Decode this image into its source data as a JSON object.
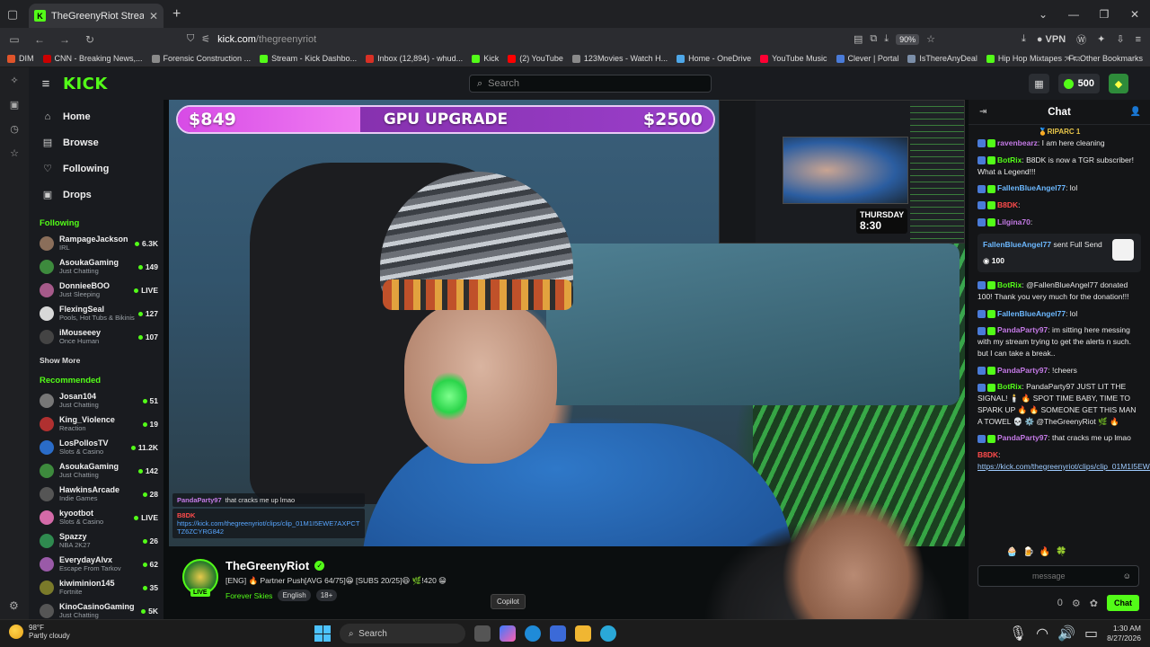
{
  "browser": {
    "tab_title": "TheGreenyRiot Stream - Watch",
    "url_host": "kick.com",
    "url_path": "/thegreenyriot",
    "zoom": "90%",
    "vpn_label": "VPN",
    "bookmarks": [
      {
        "label": "DIM",
        "color": "#e0542a"
      },
      {
        "label": "CNN - Breaking News,...",
        "color": "#cc0000"
      },
      {
        "label": "Forensic Construction ...",
        "color": "#8a8a8a"
      },
      {
        "label": "Stream - Kick Dashbo...",
        "color": "#53fc18"
      },
      {
        "label": "Inbox (12,894) - whud...",
        "color": "#d93025"
      },
      {
        "label": "Kick",
        "color": "#53fc18"
      },
      {
        "label": "(2) YouTube",
        "color": "#ff0000"
      },
      {
        "label": "123Movies - Watch H...",
        "color": "#8a8a8a"
      },
      {
        "label": "Home - OneDrive",
        "color": "#4ea7e8"
      },
      {
        "label": "YouTube Music",
        "color": "#ff0033"
      },
      {
        "label": "Clever | Portal",
        "color": "#4a7bd8"
      },
      {
        "label": "IsThereAnyDeal",
        "color": "#7b8ea8"
      },
      {
        "label": "Hip Hop Mixtapes : Fr...",
        "color": "#53fc18"
      }
    ],
    "other_bookmarks": "Other Bookmarks"
  },
  "kick": {
    "logo": "KICK",
    "search_placeholder": "Search",
    "kicks_balance": "500",
    "nav": [
      {
        "label": "Home",
        "icon": "home-icon",
        "glyph": "⌂"
      },
      {
        "label": "Browse",
        "icon": "browse-icon",
        "glyph": "▤"
      },
      {
        "label": "Following",
        "icon": "heart-icon",
        "glyph": "♡"
      },
      {
        "label": "Drops",
        "icon": "drops-icon",
        "glyph": "▣"
      }
    ],
    "following_title": "Following",
    "following": [
      {
        "name": "RampageJackson",
        "category": "IRL",
        "viewers": "6.3K",
        "color": "#8a6e5a"
      },
      {
        "name": "AsoukaGaming",
        "category": "Just Chatting",
        "viewers": "149",
        "color": "#3d8a3d"
      },
      {
        "name": "DonnieeBOO",
        "category": "Just Sleeping",
        "viewers": "LIVE",
        "color": "#a65a8a"
      },
      {
        "name": "FlexingSeal",
        "category": "Pools, Hot Tubs & Bikinis",
        "viewers": "127",
        "color": "#d8d8d8"
      },
      {
        "name": "iMouseeey",
        "category": "Once Human",
        "viewers": "107",
        "color": "#444"
      }
    ],
    "show_more": "Show More",
    "recommended_title": "Recommended",
    "recommended": [
      {
        "name": "Josan104",
        "category": "Just Chatting",
        "viewers": "51",
        "color": "#777"
      },
      {
        "name": "King_Violence",
        "category": "Reaction",
        "viewers": "19",
        "color": "#b03030"
      },
      {
        "name": "LosPollosTV",
        "category": "Slots & Casino",
        "viewers": "11.2K",
        "color": "#2a6cc8"
      },
      {
        "name": "AsoukaGaming",
        "category": "Just Chatting",
        "viewers": "142",
        "color": "#3d8a3d"
      },
      {
        "name": "HawkinsArcade",
        "category": "Indie Games",
        "viewers": "28",
        "color": "#555"
      },
      {
        "name": "kyootbot",
        "category": "Slots & Casino",
        "viewers": "LIVE",
        "color": "#d46aa8"
      },
      {
        "name": "Spazzy",
        "category": "NBA 2K27",
        "viewers": "26",
        "color": "#2f8a4f"
      },
      {
        "name": "EverydayAlvx",
        "category": "Escape From Tarkov",
        "viewers": "62",
        "color": "#9a5aa8"
      },
      {
        "name": "kiwiminion145",
        "category": "Fortnite",
        "viewers": "35",
        "color": "#7a7a2a"
      },
      {
        "name": "KinoCasinoGaming",
        "category": "Just Chatting",
        "viewers": "5K",
        "color": "#555"
      }
    ]
  },
  "overlay": {
    "goal_current": "$849",
    "goal_title": "GPU UPGRADE",
    "goal_target": "$2500",
    "goal_progress": 0.34,
    "pip_day": "THURSDAY",
    "pip_time": "8:30",
    "chat_line_user": "PandaParty97",
    "chat_line_text": "that cracks me up lmao",
    "chat_line2_user": "B8DK",
    "chat_link": "https://kick.com/thegreenyriot/clips/clip_01M1I5EWE7AXPCTTZ6ZCYRG842"
  },
  "stream": {
    "name": "TheGreenyRiot",
    "live_label": "LIVE",
    "title": "[ENG] 🔥 Partner Push[AVG 64/75]😁 [SUBS 20/25]😆 🌿!420 😁",
    "category": "Forever Skies",
    "tags": [
      "English",
      "18+"
    ]
  },
  "chat": {
    "title": "Chat",
    "pinned": "RIPARC 1",
    "messages": [
      {
        "user": "ravenbearz",
        "text": "I am here cleaning",
        "color": "#c47ae6"
      },
      {
        "user": "BotRix",
        "text": "B8DK is now a TGR subscriber! What a Legend!!!",
        "color": "#53fc18"
      },
      {
        "user": "FallenBlueAngel77",
        "text": "lol",
        "color": "#6cb8ff"
      },
      {
        "user": "B8DK",
        "text": "",
        "color": "#ff4b4b"
      },
      {
        "user": "Lilgina70",
        "text": "",
        "color": "#c47ae6"
      }
    ],
    "gift": {
      "user": "FallenBlueAngel77",
      "text": "sent Full Send",
      "amount": "100"
    },
    "messages2": [
      {
        "user": "BotRix",
        "text": "@FallenBlueAngel77 donated 100! Thank you very much for the donation!!!",
        "color": "#53fc18"
      },
      {
        "user": "FallenBlueAngel77",
        "text": "lol",
        "color": "#6cb8ff"
      },
      {
        "user": "PandaParty97",
        "text": "im sitting here messing with my stream trying to get the alerts n such. but I can take a break..",
        "color": "#c47ae6"
      },
      {
        "user": "PandaParty97",
        "text": "!cheers",
        "color": "#c47ae6"
      },
      {
        "user": "BotRix",
        "text": "PandaParty97 JUST LIT THE SIGNAL! 🕯️ 🔥 SPOT TIME BABY, TIME TO SPARK UP 🔥 🔥 SOMEONE GET THIS MAN A TOWEL 💀 ⚙️ @TheGreenyRiot 🌿 🔥",
        "color": "#53fc18"
      },
      {
        "user": "PandaParty97",
        "text": "that cracks me up lmao",
        "color": "#c47ae6"
      }
    ],
    "link_user": "B8DK",
    "link": "https://kick.com/thegreenyriot/clips/clip_01M1I5EWE7AXPCTTZ6ZCYRG842",
    "input_placeholder": "message",
    "send_label": "Chat",
    "count": "0"
  },
  "tooltip": "Copilot",
  "taskbar": {
    "weather_temp": "98°F",
    "weather_desc": "Partly cloudy",
    "search": "Search",
    "time": "1:30 AM",
    "date": "8/27/2026"
  }
}
